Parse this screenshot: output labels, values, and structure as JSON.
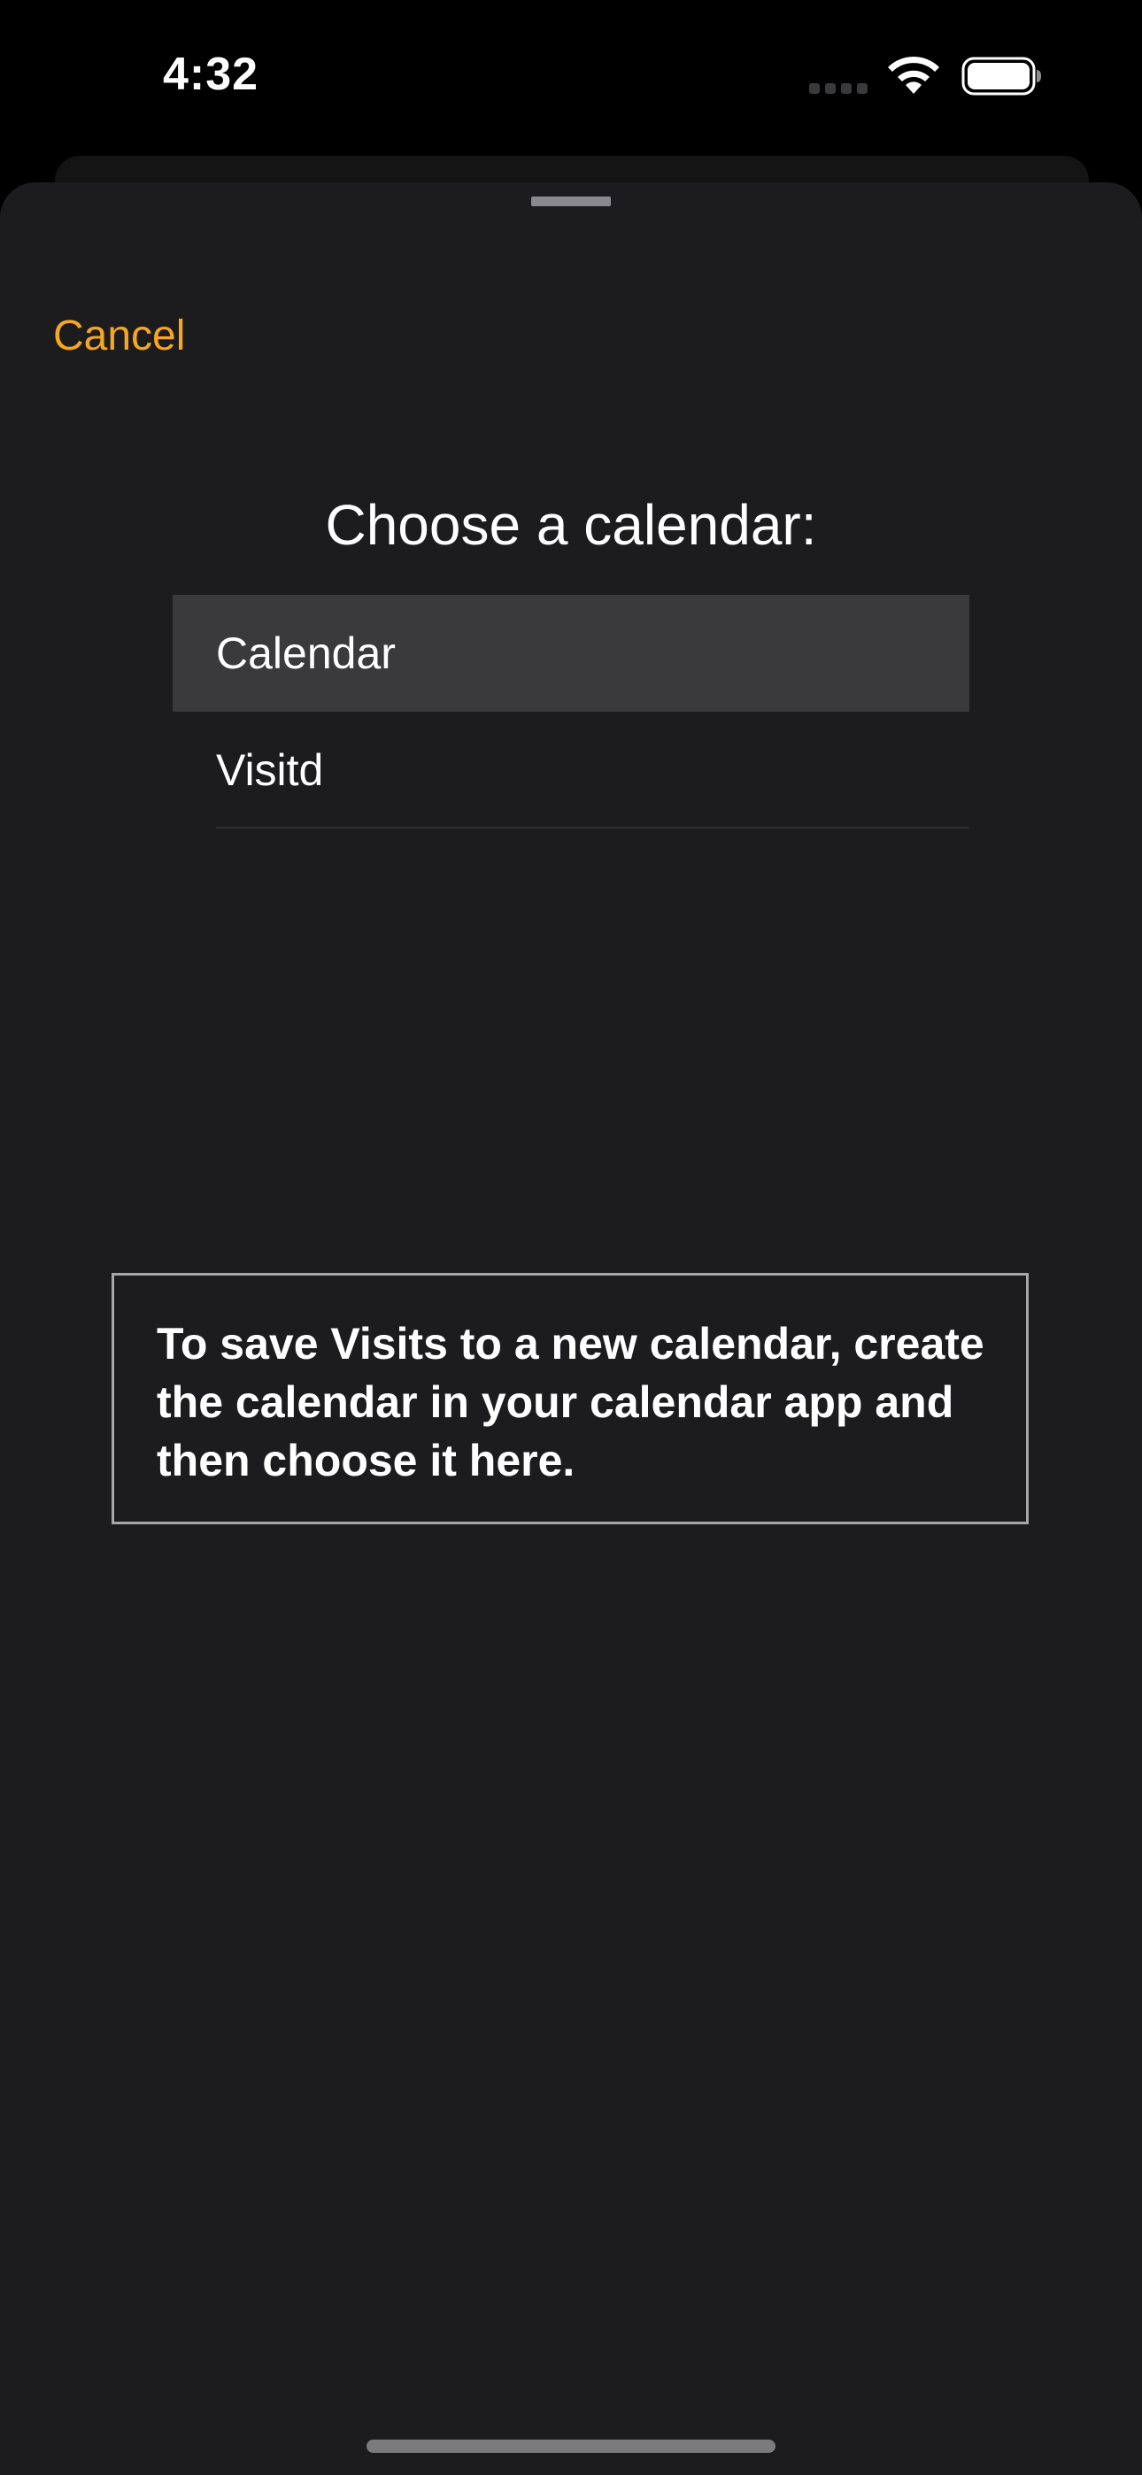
{
  "status_bar": {
    "time": "4:32"
  },
  "sheet": {
    "cancel_label": "Cancel",
    "title": "Choose a calendar:",
    "calendars": [
      {
        "label": "Calendar",
        "selected": true
      },
      {
        "label": "Visitd",
        "selected": false
      }
    ],
    "info_text": "To save Visits to a new calendar, create the calendar in your calendar app and then choose it here."
  },
  "colors": {
    "accent": "#f5a623",
    "sheet_background": "#1c1c1e",
    "selected_row": "#3a3a3c"
  },
  "icons": [
    "signal-icon",
    "wifi-icon",
    "battery-icon"
  ]
}
